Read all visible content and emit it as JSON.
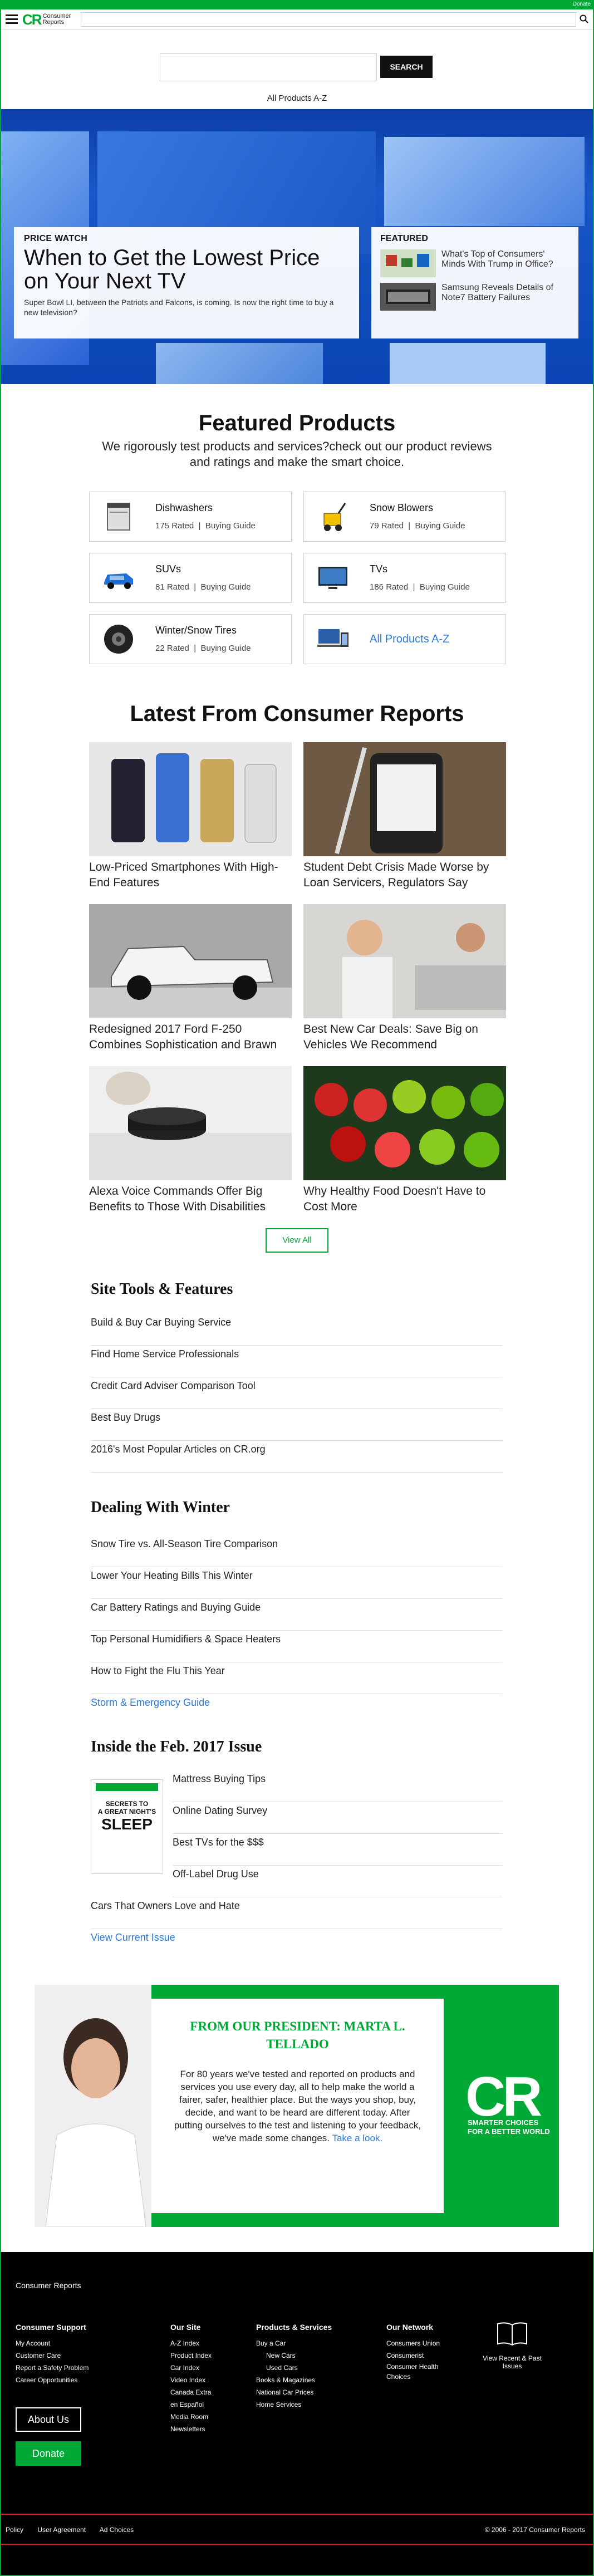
{
  "topbar": {
    "donate": "Donate"
  },
  "header": {
    "brand_line1": "Consumer",
    "brand_line2": "Reports",
    "brand_mark": "CR"
  },
  "search": {
    "placeholder": "",
    "button": "SEARCH"
  },
  "all_products_link": "All Products A-Z",
  "hero": {
    "kicker": "PRICE WATCH",
    "title": "When to Get the Lowest Price on Your Next TV",
    "desc": "Super Bowl LI, between the Patriots and Falcons, is coming. Is now the right time to buy a new television?",
    "featured_label": "FEATURED",
    "featured": [
      {
        "text": "What's Top of Consumers' Minds With Trump in Office?"
      },
      {
        "text": "Samsung Reveals Details of Note7 Battery Failures"
      }
    ]
  },
  "featured_products": {
    "title": "Featured Products",
    "subtitle": "We rigorously test products and services?check out our product reviews and ratings and make the smart choice.",
    "items": [
      {
        "name": "Dishwashers",
        "rated": "175 Rated",
        "guide": "Buying Guide",
        "icon": "dishwasher-icon"
      },
      {
        "name": "Snow Blowers",
        "rated": "79 Rated",
        "guide": "Buying Guide",
        "icon": "snow-blower-icon"
      },
      {
        "name": "SUVs",
        "rated": "81 Rated",
        "guide": "Buying Guide",
        "icon": "suv-icon"
      },
      {
        "name": "TVs",
        "rated": "186 Rated",
        "guide": "Buying Guide",
        "icon": "tv-icon"
      },
      {
        "name": "Winter/Snow Tires",
        "rated": "22 Rated",
        "guide": "Buying Guide",
        "icon": "tire-icon"
      },
      {
        "name": "All Products A-Z",
        "icon": "devices-icon"
      }
    ],
    "separator": "|"
  },
  "latest": {
    "title": "Latest From Consumer Reports",
    "articles": [
      {
        "caption": "Low-Priced Smartphones With High-End Features"
      },
      {
        "caption": "Student Debt Crisis Made Worse by Loan Servicers, Regulators Say"
      },
      {
        "caption": "Redesigned 2017 Ford F-250 Combines Sophistication and Brawn"
      },
      {
        "caption": "Best New Car Deals: Save Big on Vehicles We Recommend"
      },
      {
        "caption": "Alexa Voice Commands Offer Big Benefits to Those With Disabilities"
      },
      {
        "caption": "Why Healthy Food Doesn't Have to Cost More"
      }
    ],
    "view_all": "View All"
  },
  "site_tools": {
    "title": "Site Tools & Features",
    "items": [
      "Build & Buy Car Buying Service",
      "Find Home Service Professionals",
      "Credit Card Adviser Comparison Tool",
      "Best Buy Drugs",
      "2016's Most Popular Articles on CR.org"
    ]
  },
  "winter": {
    "title": "Dealing With Winter",
    "items": [
      "Snow Tire vs. All-Season Tire Comparison",
      "Lower Your Heating Bills This Winter",
      "Car Battery Ratings and Buying Guide",
      "Top Personal Humidifiers & Space Heaters",
      "How to Fight the Flu This Year"
    ],
    "link": "Storm & Emergency Guide"
  },
  "issue": {
    "title": "Inside the Feb. 2017 Issue",
    "cover_lines": [
      "SECRETS TO",
      "A GREAT NIGHT'S",
      "SLEEP"
    ],
    "items": [
      "Mattress Buying Tips",
      "Online Dating Survey",
      "Best TVs for the $$$",
      "Off-Label Drug Use",
      "Cars That Owners Love and Hate"
    ],
    "link": "View Current Issue"
  },
  "president": {
    "heading": "FROM OUR PRESIDENT: MARTA L. TELLADO",
    "body": "For 80 years we've tested and reported on products and services you use every day, all to help make the world a fairer, safer, healthier place. But the ways you shop, buy, decide, and want to be heard are different today. After putting ourselves to the test and listening to your feedback, we've made some changes.",
    "link": "Take a look.",
    "logo": "CR",
    "tagline": "SMARTER CHOICES FOR A BETTER WORLD"
  },
  "footer": {
    "brand": "Consumer Reports",
    "support": {
      "title": "Consumer Support",
      "items": [
        "My Account",
        "Customer Care",
        "Report a Safety Problem",
        "Career Opportunities"
      ]
    },
    "oursite": {
      "title": "Our Site",
      "items": [
        "A-Z Index",
        "Product Index",
        "Car Index",
        "Video Index",
        "Canada Extra",
        "en Español",
        "Media Room",
        "Newsletters"
      ]
    },
    "products": {
      "title": "Products & Services",
      "items": [
        "Buy a Car",
        "New Cars",
        "Used Cars",
        "Books & Magazines",
        "National Car Prices",
        "Home Services"
      ]
    },
    "network": {
      "title": "Our Network",
      "items": [
        "Consumers Union",
        "Consumerist",
        "Consumer Health Choices"
      ]
    },
    "about": "About Us",
    "donate": "Donate",
    "issues": "View Recent & Past Issues",
    "bottom_links": [
      "Policy",
      "User Agreement",
      "Ad Choices"
    ],
    "copyright": "© 2006 - 2017 Consumer Reports"
  }
}
